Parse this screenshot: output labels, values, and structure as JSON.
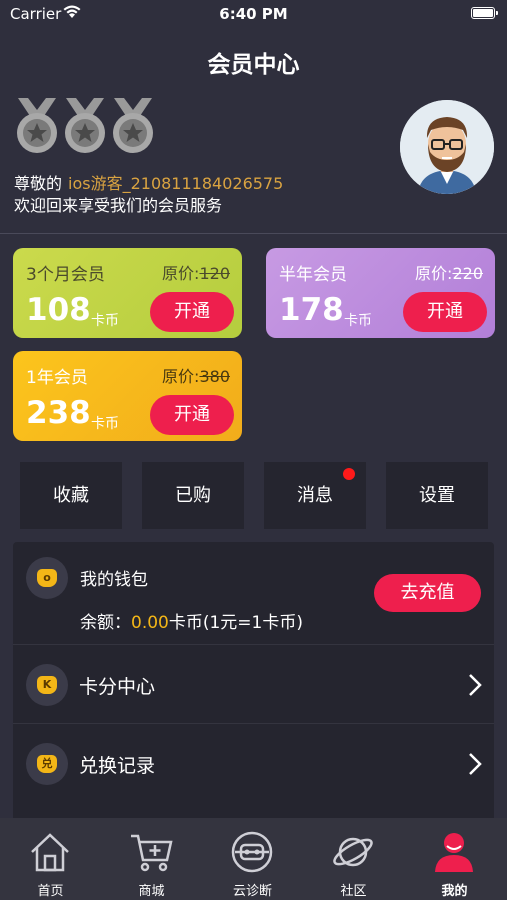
{
  "status_bar": {
    "carrier": "Carrier",
    "time": "6:40 PM"
  },
  "page_title": "会员中心",
  "user": {
    "greeting_prefix": "尊敬的",
    "username": "ios游客_210811184026575",
    "welcome": "欢迎回来享受我们的会员服务"
  },
  "plans": [
    {
      "name": "3个月会员",
      "orig_label": "原价:",
      "orig_price": "120",
      "price": "108",
      "unit": "卡币",
      "button": "开通"
    },
    {
      "name": "半年会员",
      "orig_label": "原价:",
      "orig_price": "220",
      "price": "178",
      "unit": "卡币",
      "button": "开通"
    },
    {
      "name": "1年会员",
      "orig_label": "原价:",
      "orig_price": "380",
      "price": "238",
      "unit": "卡币",
      "button": "开通"
    }
  ],
  "quick_actions": [
    "收藏",
    "已购",
    "消息",
    "设置"
  ],
  "wallet": {
    "title": "我的钱包",
    "balance_label": "余额：",
    "balance_amount": "0.00",
    "balance_suffix": "卡币(1元=1卡币)",
    "recharge_button": "去充值",
    "icon_glyph": "o"
  },
  "menu": [
    {
      "label": "卡分中心",
      "icon_glyph": "K"
    },
    {
      "label": "兑换记录",
      "icon_glyph": "兑"
    }
  ],
  "tabs": [
    "首页",
    "商城",
    "云诊断",
    "社区",
    "我的"
  ],
  "colors": {
    "accent_red": "#ee1f4d",
    "gold": "#d9a341",
    "background": "#2f2f3d"
  }
}
